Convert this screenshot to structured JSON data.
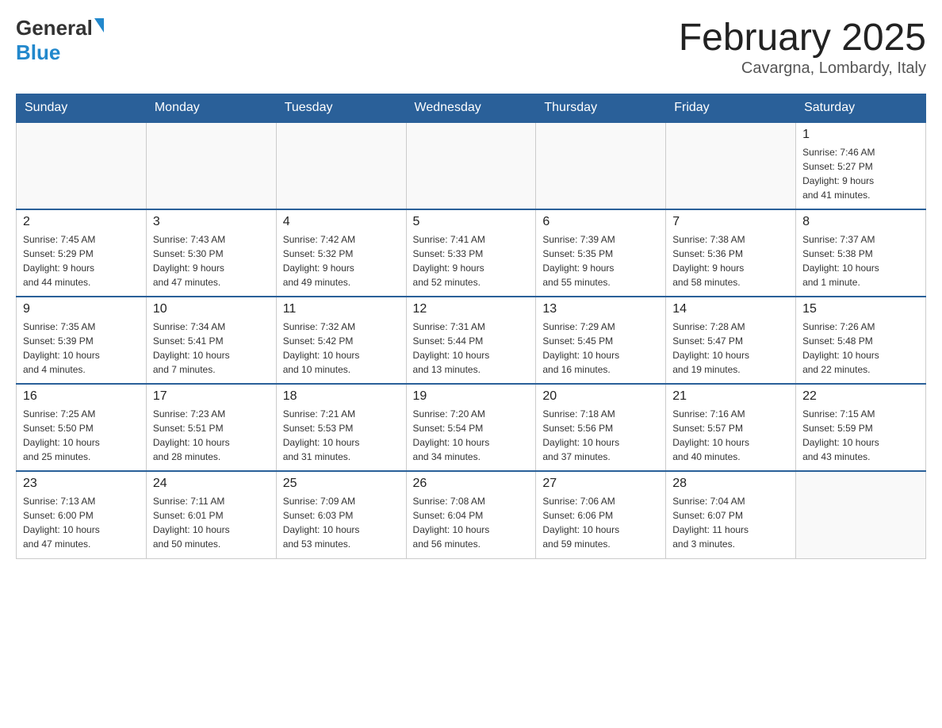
{
  "header": {
    "logo_text_general": "General",
    "logo_text_blue": "Blue",
    "title": "February 2025",
    "subtitle": "Cavargna, Lombardy, Italy"
  },
  "calendar": {
    "days_of_week": [
      "Sunday",
      "Monday",
      "Tuesday",
      "Wednesday",
      "Thursday",
      "Friday",
      "Saturday"
    ],
    "weeks": [
      [
        {
          "day": "",
          "info": ""
        },
        {
          "day": "",
          "info": ""
        },
        {
          "day": "",
          "info": ""
        },
        {
          "day": "",
          "info": ""
        },
        {
          "day": "",
          "info": ""
        },
        {
          "day": "",
          "info": ""
        },
        {
          "day": "1",
          "info": "Sunrise: 7:46 AM\nSunset: 5:27 PM\nDaylight: 9 hours\nand 41 minutes."
        }
      ],
      [
        {
          "day": "2",
          "info": "Sunrise: 7:45 AM\nSunset: 5:29 PM\nDaylight: 9 hours\nand 44 minutes."
        },
        {
          "day": "3",
          "info": "Sunrise: 7:43 AM\nSunset: 5:30 PM\nDaylight: 9 hours\nand 47 minutes."
        },
        {
          "day": "4",
          "info": "Sunrise: 7:42 AM\nSunset: 5:32 PM\nDaylight: 9 hours\nand 49 minutes."
        },
        {
          "day": "5",
          "info": "Sunrise: 7:41 AM\nSunset: 5:33 PM\nDaylight: 9 hours\nand 52 minutes."
        },
        {
          "day": "6",
          "info": "Sunrise: 7:39 AM\nSunset: 5:35 PM\nDaylight: 9 hours\nand 55 minutes."
        },
        {
          "day": "7",
          "info": "Sunrise: 7:38 AM\nSunset: 5:36 PM\nDaylight: 9 hours\nand 58 minutes."
        },
        {
          "day": "8",
          "info": "Sunrise: 7:37 AM\nSunset: 5:38 PM\nDaylight: 10 hours\nand 1 minute."
        }
      ],
      [
        {
          "day": "9",
          "info": "Sunrise: 7:35 AM\nSunset: 5:39 PM\nDaylight: 10 hours\nand 4 minutes."
        },
        {
          "day": "10",
          "info": "Sunrise: 7:34 AM\nSunset: 5:41 PM\nDaylight: 10 hours\nand 7 minutes."
        },
        {
          "day": "11",
          "info": "Sunrise: 7:32 AM\nSunset: 5:42 PM\nDaylight: 10 hours\nand 10 minutes."
        },
        {
          "day": "12",
          "info": "Sunrise: 7:31 AM\nSunset: 5:44 PM\nDaylight: 10 hours\nand 13 minutes."
        },
        {
          "day": "13",
          "info": "Sunrise: 7:29 AM\nSunset: 5:45 PM\nDaylight: 10 hours\nand 16 minutes."
        },
        {
          "day": "14",
          "info": "Sunrise: 7:28 AM\nSunset: 5:47 PM\nDaylight: 10 hours\nand 19 minutes."
        },
        {
          "day": "15",
          "info": "Sunrise: 7:26 AM\nSunset: 5:48 PM\nDaylight: 10 hours\nand 22 minutes."
        }
      ],
      [
        {
          "day": "16",
          "info": "Sunrise: 7:25 AM\nSunset: 5:50 PM\nDaylight: 10 hours\nand 25 minutes."
        },
        {
          "day": "17",
          "info": "Sunrise: 7:23 AM\nSunset: 5:51 PM\nDaylight: 10 hours\nand 28 minutes."
        },
        {
          "day": "18",
          "info": "Sunrise: 7:21 AM\nSunset: 5:53 PM\nDaylight: 10 hours\nand 31 minutes."
        },
        {
          "day": "19",
          "info": "Sunrise: 7:20 AM\nSunset: 5:54 PM\nDaylight: 10 hours\nand 34 minutes."
        },
        {
          "day": "20",
          "info": "Sunrise: 7:18 AM\nSunset: 5:56 PM\nDaylight: 10 hours\nand 37 minutes."
        },
        {
          "day": "21",
          "info": "Sunrise: 7:16 AM\nSunset: 5:57 PM\nDaylight: 10 hours\nand 40 minutes."
        },
        {
          "day": "22",
          "info": "Sunrise: 7:15 AM\nSunset: 5:59 PM\nDaylight: 10 hours\nand 43 minutes."
        }
      ],
      [
        {
          "day": "23",
          "info": "Sunrise: 7:13 AM\nSunset: 6:00 PM\nDaylight: 10 hours\nand 47 minutes."
        },
        {
          "day": "24",
          "info": "Sunrise: 7:11 AM\nSunset: 6:01 PM\nDaylight: 10 hours\nand 50 minutes."
        },
        {
          "day": "25",
          "info": "Sunrise: 7:09 AM\nSunset: 6:03 PM\nDaylight: 10 hours\nand 53 minutes."
        },
        {
          "day": "26",
          "info": "Sunrise: 7:08 AM\nSunset: 6:04 PM\nDaylight: 10 hours\nand 56 minutes."
        },
        {
          "day": "27",
          "info": "Sunrise: 7:06 AM\nSunset: 6:06 PM\nDaylight: 10 hours\nand 59 minutes."
        },
        {
          "day": "28",
          "info": "Sunrise: 7:04 AM\nSunset: 6:07 PM\nDaylight: 11 hours\nand 3 minutes."
        },
        {
          "day": "",
          "info": ""
        }
      ]
    ]
  }
}
